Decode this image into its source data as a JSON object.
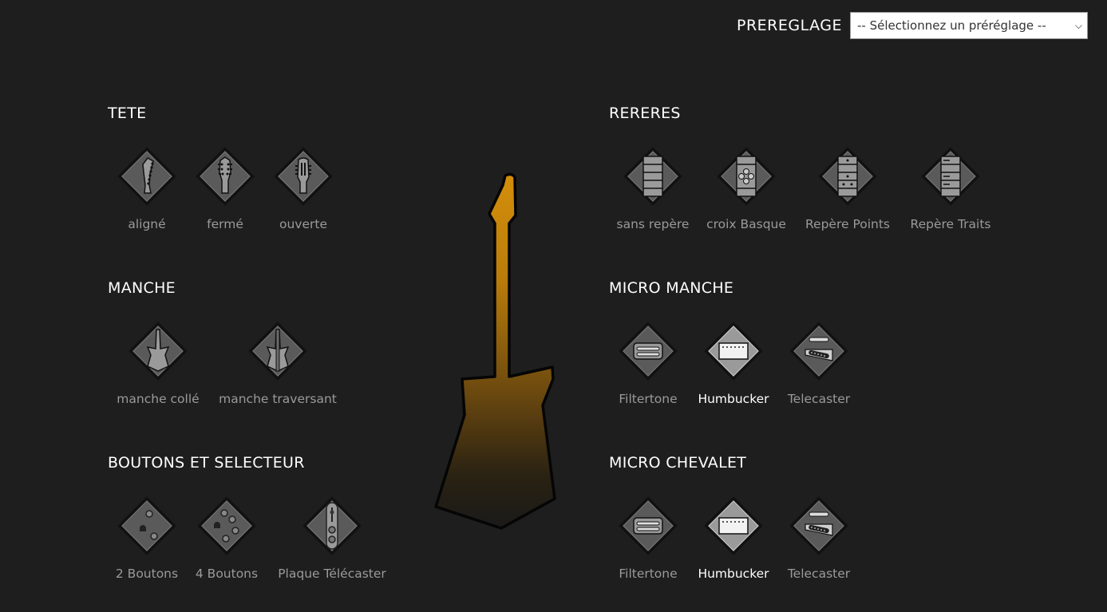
{
  "preset": {
    "label": "PREREGLAGE",
    "selected": "-- Sélectionnez un préréglage --"
  },
  "sections": {
    "tete": {
      "title": "TETE",
      "options": [
        {
          "label": "aligné",
          "icon": "headstock-aligned-icon"
        },
        {
          "label": "fermé",
          "icon": "headstock-closed-icon"
        },
        {
          "label": "ouverte",
          "icon": "headstock-open-icon"
        }
      ]
    },
    "manche": {
      "title": "MANCHE",
      "options": [
        {
          "label": "manche collé",
          "icon": "neck-set-icon"
        },
        {
          "label": "manche traversant",
          "icon": "neck-through-icon"
        }
      ]
    },
    "boutons": {
      "title": "BOUTONS ET SELECTEUR",
      "options": [
        {
          "label": "2 Boutons",
          "icon": "two-knobs-icon"
        },
        {
          "label": "4 Boutons",
          "icon": "four-knobs-icon"
        },
        {
          "label": "Plaque Télécaster",
          "icon": "tele-plate-icon"
        }
      ]
    },
    "reperes": {
      "title": "RERERES",
      "options": [
        {
          "label": "sans repère",
          "icon": "fretboard-plain-icon"
        },
        {
          "label": "croix Basque",
          "icon": "fretboard-basque-cross-icon"
        },
        {
          "label": "Repère Points",
          "icon": "fretboard-dots-icon"
        },
        {
          "label": "Repère Traits",
          "icon": "fretboard-lines-icon"
        }
      ]
    },
    "micro_manche": {
      "title": "MICRO MANCHE",
      "options": [
        {
          "label": "Filtertone",
          "icon": "pickup-filtertone-icon"
        },
        {
          "label": "Humbucker",
          "icon": "pickup-humbucker-icon",
          "selected": true
        },
        {
          "label": "Telecaster",
          "icon": "pickup-telecaster-icon"
        }
      ]
    },
    "micro_chevalet": {
      "title": "MICRO CHEVALET",
      "options": [
        {
          "label": "Filtertone",
          "icon": "pickup-filtertone-icon"
        },
        {
          "label": "Humbucker",
          "icon": "pickup-humbucker-icon",
          "selected": true
        },
        {
          "label": "Telecaster",
          "icon": "pickup-telecaster-icon"
        }
      ]
    }
  },
  "colors": {
    "background": "#1e1e1e",
    "guitar_top": "#d48e0a",
    "guitar_bottom": "#1a1a1a",
    "label_inactive": "#9a9a9a",
    "label_active": "#ffffff"
  }
}
